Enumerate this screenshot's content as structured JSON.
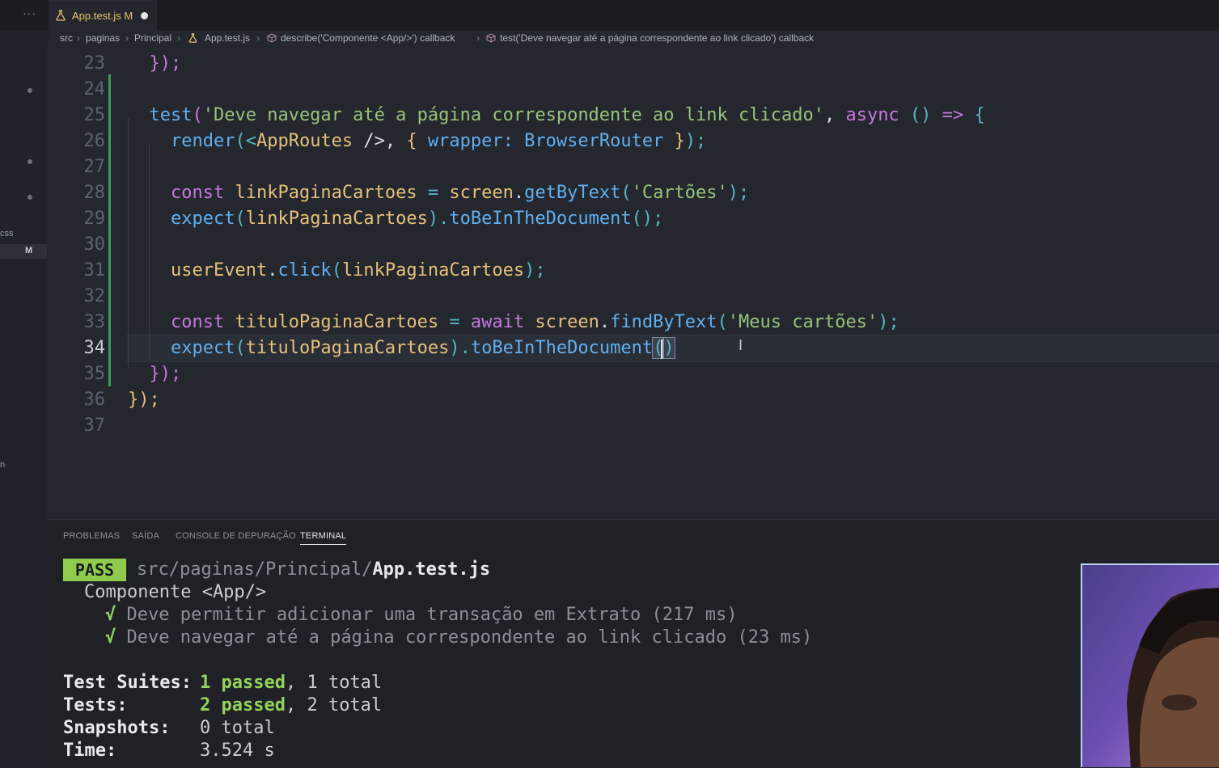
{
  "tab": {
    "filename": "App.test.js",
    "status": "M"
  },
  "breadcrumb": {
    "items": [
      "src",
      "paginas",
      "Principal",
      "App.test.js",
      "describe('Componente <App/>') callback",
      "test('Deve navegar até a página correspondente ao link clicado') callback"
    ]
  },
  "sidebar": {
    "label_css": "css",
    "label_m": "M",
    "label_n": "n"
  },
  "editor": {
    "line_numbers": [
      "23",
      "24",
      "25",
      "26",
      "27",
      "28",
      "29",
      "30",
      "31",
      "32",
      "33",
      "34",
      "35",
      "36",
      "37"
    ],
    "active_line": "34",
    "code": {
      "l23_a": "});",
      "l25_a": "test",
      "l25_b": "(",
      "l25_c": "'Deve navegar até a página correspondente ao link clicado'",
      "l25_d": ", ",
      "l25_e": "async",
      "l25_f": " () ",
      "l25_g": "=>",
      "l25_h": " {",
      "l26_a": "render",
      "l26_b": "(<",
      "l26_c": "AppRoutes",
      "l26_d": " />, ",
      "l26_e": "{",
      "l26_f": " wrapper: ",
      "l26_g": "BrowserRouter",
      "l26_h": " }",
      "l26_i": ");",
      "l28_a": "const",
      "l28_b": " linkPaginaCartoes ",
      "l28_c": "=",
      "l28_d": " screen",
      "l28_e": ".",
      "l28_f": "getByText",
      "l28_g": "(",
      "l28_h": "'Cartões'",
      "l28_i": ");",
      "l29_a": "expect",
      "l29_b": "(",
      "l29_c": "linkPaginaCartoes",
      "l29_d": ").",
      "l29_e": "toBeInTheDocument",
      "l29_f": "();",
      "l31_a": "userEvent",
      "l31_b": ".",
      "l31_c": "click",
      "l31_d": "(",
      "l31_e": "linkPaginaCartoes",
      "l31_f": ");",
      "l33_a": "const",
      "l33_b": " tituloPaginaCartoes ",
      "l33_c": "=",
      "l33_d": " await",
      "l33_e": " screen",
      "l33_f": ".",
      "l33_g": "findByText",
      "l33_h": "(",
      "l33_i": "'Meus cartões'",
      "l33_j": ");",
      "l34_a": "expect",
      "l34_b": "(",
      "l34_c": "tituloPaginaCartoes",
      "l34_d": ").",
      "l34_e": "toBeInTheDocument",
      "l34_f": "(",
      "l34_g": ")",
      "l35_a": "});",
      "l36_a": "});"
    }
  },
  "panel": {
    "tabs": [
      "PROBLEMAS",
      "SAÍDA",
      "CONSOLE DE DEPURAÇÃO",
      "TERMINAL"
    ],
    "active_tab": "TERMINAL",
    "terminal": {
      "pass_badge": "PASS",
      "path_dim": "src/paginas/Principal/",
      "path_file": "App.test.js",
      "suite": "Componente <App/>",
      "check": "√",
      "test1": "Deve permitir adicionar uma transação em Extrato (217 ms)",
      "test2": "Deve navegar até a página correspondente ao link clicado (23 ms)",
      "suites_label": "Test Suites:",
      "suites_passed": "1 passed",
      "suites_total": ", 1 total",
      "tests_label": "Tests:",
      "tests_passed": "2 passed",
      "tests_total": ", 2 total",
      "snap_label": "Snapshots:",
      "snap_value": "0 total",
      "time_label": "Time:",
      "time_value": "3.524 s"
    }
  },
  "colors": {
    "accent_green": "#8fcc4d",
    "git_added": "#3a9d5d",
    "webcam_border": "#b8d5f2"
  }
}
